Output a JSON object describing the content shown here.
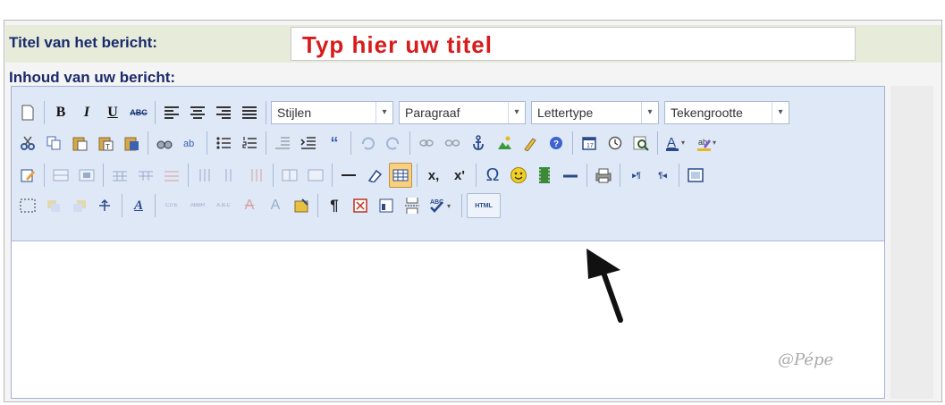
{
  "form": {
    "title_label": "Titel van het bericht:",
    "title_value": "Typ hier uw titel",
    "content_label": "Inhoud van uw bericht:"
  },
  "toolbar": {
    "styles_select": "Stijlen",
    "paragraph_select": "Paragraaf",
    "font_select": "Lettertype",
    "fontsize_select": "Tekengrootte",
    "bold_label": "B",
    "italic_label": "I",
    "underline_label": "U",
    "strike_label": "ABC",
    "html_label": "HTML",
    "subscript_label": "x,",
    "superscript_label": "x'",
    "omega_label": "Ω",
    "pilcrow_label": "¶"
  },
  "watermark": "@Pépe",
  "colors": {
    "title_text": "#d81b1b",
    "label_text": "#1a2a6c",
    "toolbar_bg": "#dfe8f6"
  }
}
